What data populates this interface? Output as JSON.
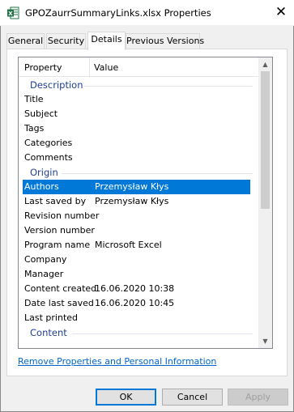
{
  "window": {
    "title": "GPOZaurrSummaryLinks.xlsx Properties",
    "app_icon": "excel-icon",
    "close_glyph": "✕"
  },
  "tabs": [
    {
      "label": "General"
    },
    {
      "label": "Security"
    },
    {
      "label": "Details",
      "active": true
    },
    {
      "label": "Previous Versions"
    }
  ],
  "list": {
    "columns": {
      "property": "Property",
      "value": "Value"
    },
    "groups": {
      "description": "Description",
      "origin": "Origin",
      "content": "Content"
    },
    "description_rows": [
      {
        "key": "Title",
        "value": ""
      },
      {
        "key": "Subject",
        "value": ""
      },
      {
        "key": "Tags",
        "value": ""
      },
      {
        "key": "Categories",
        "value": ""
      },
      {
        "key": "Comments",
        "value": ""
      }
    ],
    "origin_rows": [
      {
        "key": "Authors",
        "value": "Przemysław Kłys"
      },
      {
        "key": "Last saved by",
        "value": "Przemysław Kłys"
      },
      {
        "key": "Revision number",
        "value": ""
      },
      {
        "key": "Version number",
        "value": ""
      },
      {
        "key": "Program name",
        "value": "Microsoft Excel"
      },
      {
        "key": "Company",
        "value": ""
      },
      {
        "key": "Manager",
        "value": ""
      },
      {
        "key": "Content created",
        "value": "16.06.2020 10:38"
      },
      {
        "key": "Date last saved",
        "value": "16.06.2020 10:45"
      },
      {
        "key": "Last printed",
        "value": ""
      }
    ],
    "selected_row": "Authors"
  },
  "link": {
    "label": "Remove Properties and Personal Information"
  },
  "buttons": {
    "ok": "OK",
    "cancel": "Cancel",
    "apply": "Apply"
  },
  "colors": {
    "accent": "#0078d7",
    "group": "#1e3f8f",
    "link": "#0066cc"
  }
}
